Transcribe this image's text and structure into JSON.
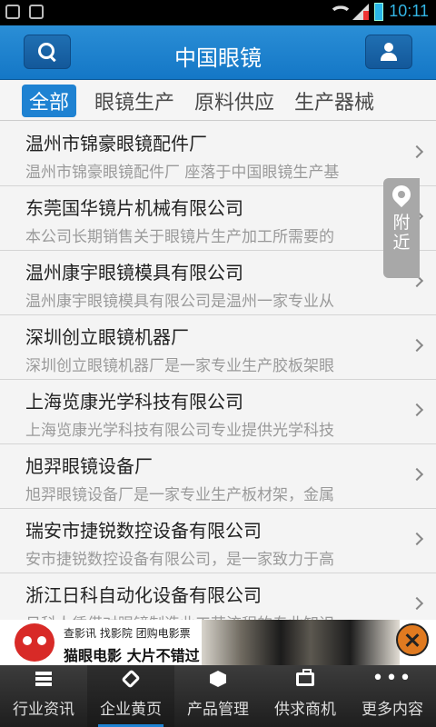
{
  "status_bar": {
    "time": "10:11"
  },
  "header": {
    "title": "中国眼镜"
  },
  "categories": [
    "全部",
    "眼镜生产",
    "原料供应",
    "生产器械"
  ],
  "listings": [
    {
      "title": "温州市锦豪眼镜配件厂",
      "desc": "温州市锦豪眼镜配件厂 座落于中国眼镜生产基"
    },
    {
      "title": "东莞国华镜片机械有限公司",
      "desc": "本公司长期销售关于眼镜片生产加工所需要的"
    },
    {
      "title": "温州康宇眼镜模具有限公司",
      "desc": "温州康宇眼镜模具有限公司是温州一家专业从"
    },
    {
      "title": "深圳创立眼镜机器厂",
      "desc": "深圳创立眼镜机器厂是一家专业生产胶板架眼"
    },
    {
      "title": "上海览康光学科技有限公司",
      "desc": "上海览康光学科技有限公司专业提供光学科技"
    },
    {
      "title": "旭羿眼镜设备厂",
      "desc": "旭羿眼镜设备厂是一家专业生产板材架，金属"
    },
    {
      "title": "瑞安市捷锐数控设备有限公司",
      "desc": "安市捷锐数控设备有限公司，是一家致力于高"
    },
    {
      "title": "浙江日科自动化设备有限公司",
      "desc": "日科人凭借对眼镜制造业工艺流程的专业知识"
    }
  ],
  "nearby": {
    "label_1": "附",
    "label_2": "近"
  },
  "ad": {
    "sub_text": "查影讯 找影院 团购电影票",
    "main_text": "猫眼电影 大片不错过"
  },
  "bottom_nav": [
    {
      "label": "行业资讯",
      "icon": "grid-icon"
    },
    {
      "label": "企业黄页",
      "icon": "tag-icon"
    },
    {
      "label": "产品管理",
      "icon": "box-icon"
    },
    {
      "label": "供求商机",
      "icon": "briefcase-icon"
    },
    {
      "label": "更多内容",
      "icon": "more-icon"
    }
  ]
}
